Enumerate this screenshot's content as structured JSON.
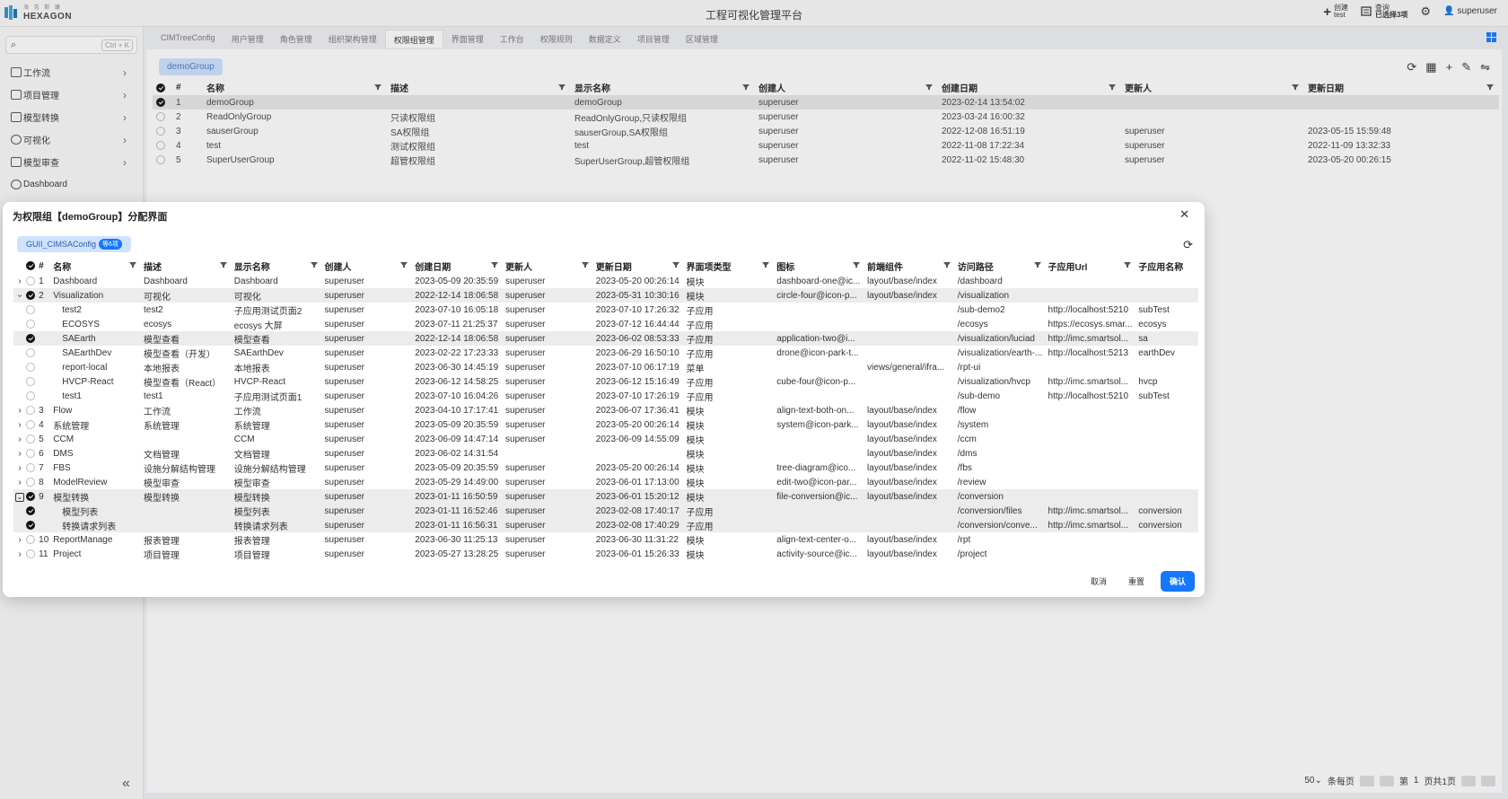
{
  "app": {
    "logo_sub": "海 克 斯 康",
    "logo_name": "HEXAGON",
    "title": "工程可视化管理平台"
  },
  "top_actions": [
    {
      "label": "创建",
      "value": "test",
      "icon": "plus-icon"
    },
    {
      "label": "查询",
      "value": "已选择3项",
      "icon": "query-icon"
    },
    {
      "label": "",
      "value": "",
      "icon": "gear-icon"
    },
    {
      "label": "",
      "value": "superuser",
      "icon": "user-icon"
    }
  ],
  "sidebar": {
    "search_kbd": "Ctrl + K",
    "items": [
      {
        "label": "工作流"
      },
      {
        "label": "项目管理"
      },
      {
        "label": "模型转换"
      },
      {
        "label": "可视化"
      },
      {
        "label": "模型审查"
      },
      {
        "label": "Dashboard"
      }
    ],
    "collapse_glyph": "«"
  },
  "tabs": [
    "CIMTreeConfig",
    "用户管理",
    "角色管理",
    "组织架构管理",
    "权限组管理",
    "界面管理",
    "工作台",
    "权限规则",
    "数据定义",
    "项目管理",
    "区域管理"
  ],
  "active_tab": "权限组管理",
  "main": {
    "group_chip": "demoGroup",
    "columns": [
      "#",
      "名称",
      "描述",
      "显示名称",
      "创建人",
      "创建日期",
      "更新人",
      "更新日期"
    ],
    "rows": [
      {
        "n": "1",
        "name": "demoGroup",
        "desc": "",
        "display": "demoGroup",
        "creator": "superuser",
        "created": "2023-02-14 13:54:02",
        "updater": "",
        "updated": "",
        "checked": true
      },
      {
        "n": "2",
        "name": "ReadOnlyGroup",
        "desc": "只读权限组",
        "display": "ReadOnlyGroup,只读权限组",
        "creator": "superuser",
        "created": "2023-03-24 16:00:32",
        "updater": "",
        "updated": "",
        "checked": false
      },
      {
        "n": "3",
        "name": "sauserGroup",
        "desc": "SA权限组",
        "display": "sauserGroup,SA权限组",
        "creator": "superuser",
        "created": "2022-12-08 16:51:19",
        "updater": "superuser",
        "updated": "2023-05-15 15:59:48",
        "checked": false
      },
      {
        "n": "4",
        "name": "test",
        "desc": "测试权限组",
        "display": "test",
        "creator": "superuser",
        "created": "2022-11-08 17:22:34",
        "updater": "superuser",
        "updated": "2022-11-09 13:32:33",
        "checked": false
      },
      {
        "n": "5",
        "name": "SuperUserGroup",
        "desc": "超管权限组",
        "display": "SuperUserGroup,超管权限组",
        "creator": "superuser",
        "created": "2022-11-02 15:48:30",
        "updater": "superuser",
        "updated": "2023-05-20 00:26:15",
        "checked": false
      }
    ],
    "pager": {
      "size": "50",
      "per_page_label": "条每页",
      "page_prefix": "第",
      "page": "1",
      "page_suffix": "页共1页"
    }
  },
  "modal": {
    "title": "为权限组【demoGroup】分配界面",
    "tag_label": "GUII_CIMSAConfig",
    "tag_count": "等6项",
    "columns": [
      "#",
      "名称",
      "描述",
      "显示名称",
      "创建人",
      "创建日期",
      "更新人",
      "更新日期",
      "界面项类型",
      "图标",
      "前端组件",
      "访问路径",
      "子应用Url",
      "子应用名称"
    ],
    "rows": [
      {
        "exp": "closed",
        "level": 0,
        "checked": false,
        "n": "1",
        "name": "Dashboard",
        "desc": "Dashboard",
        "display": "Dashboard",
        "creator": "superuser",
        "created": "2023-05-09 20:35:59",
        "updater": "superuser",
        "updated": "2023-05-20 00:26:14",
        "type": "模块",
        "icon": "dashboard-one@ic...",
        "comp": "layout/base/index",
        "path": "/dashboard",
        "url": "",
        "app": ""
      },
      {
        "exp": "open",
        "level": 0,
        "checked": true,
        "sel": true,
        "n": "2",
        "name": "Visualization",
        "desc": "可视化",
        "display": "可视化",
        "creator": "superuser",
        "created": "2022-12-14 18:06:58",
        "updater": "superuser",
        "updated": "2023-05-31 10:30:16",
        "type": "模块",
        "icon": "circle-four@icon-p...",
        "comp": "layout/base/index",
        "path": "/visualization",
        "url": "",
        "app": ""
      },
      {
        "exp": "",
        "level": 1,
        "checked": false,
        "n": "",
        "name": "test2",
        "desc": "test2",
        "display": "子应用测试页面2",
        "creator": "superuser",
        "created": "2023-07-10 16:05:18",
        "updater": "superuser",
        "updated": "2023-07-10 17:26:32",
        "type": "子应用",
        "icon": "",
        "comp": "",
        "path": "/sub-demo2",
        "url": "http://localhost:5210",
        "app": "subTest"
      },
      {
        "exp": "",
        "level": 1,
        "checked": false,
        "n": "",
        "name": "ECOSYS",
        "desc": "ecosys",
        "display": "ecosys 大屏",
        "creator": "superuser",
        "created": "2023-07-11 21:25:37",
        "updater": "superuser",
        "updated": "2023-07-12 16:44:44",
        "type": "子应用",
        "icon": "",
        "comp": "",
        "path": "/ecosys",
        "url": "https://ecosys.smar...",
        "app": "ecosys"
      },
      {
        "exp": "",
        "level": 1,
        "checked": true,
        "sel": true,
        "n": "",
        "name": "SAEarth",
        "desc": "模型查看",
        "display": "模型查看",
        "creator": "superuser",
        "created": "2022-12-14 18:06:58",
        "updater": "superuser",
        "updated": "2023-06-02 08:53:33",
        "type": "子应用",
        "icon": "application-two@i...",
        "comp": "",
        "path": "/visualization/luciad",
        "url": "http://imc.smartsol...",
        "app": "sa"
      },
      {
        "exp": "",
        "level": 1,
        "checked": false,
        "n": "",
        "name": "SAEarthDev",
        "desc": "模型查看（开发）",
        "display": "SAEarthDev",
        "creator": "superuser",
        "created": "2023-02-22 17:23:33",
        "updater": "superuser",
        "updated": "2023-06-29 16:50:10",
        "type": "子应用",
        "icon": "drone@icon-park-t...",
        "comp": "",
        "path": "/visualization/earth-...",
        "url": "http://localhost:5213",
        "app": "earthDev"
      },
      {
        "exp": "",
        "level": 1,
        "checked": false,
        "n": "",
        "name": "report-local",
        "desc": "本地报表",
        "display": "本地报表",
        "creator": "superuser",
        "created": "2023-06-30 14:45:19",
        "updater": "superuser",
        "updated": "2023-07-10 06:17:19",
        "type": "菜单",
        "icon": "",
        "comp": "views/general/ifra...",
        "path": "/rpt-ui",
        "url": "",
        "app": ""
      },
      {
        "exp": "",
        "level": 1,
        "checked": false,
        "n": "",
        "name": "HVCP-React",
        "desc": "模型查看（React）",
        "display": "HVCP-React",
        "creator": "superuser",
        "created": "2023-06-12 14:58:25",
        "updater": "superuser",
        "updated": "2023-06-12 15:16:49",
        "type": "子应用",
        "icon": "cube-four@icon-p...",
        "comp": "",
        "path": "/visualization/hvcp",
        "url": "http://imc.smartsol...",
        "app": "hvcp"
      },
      {
        "exp": "",
        "level": 1,
        "checked": false,
        "n": "",
        "name": "test1",
        "desc": "test1",
        "display": "子应用测试页面1",
        "creator": "superuser",
        "created": "2023-07-10 16:04:26",
        "updater": "superuser",
        "updated": "2023-07-10 17:26:19",
        "type": "子应用",
        "icon": "",
        "comp": "",
        "path": "/sub-demo",
        "url": "http://localhost:5210",
        "app": "subTest"
      },
      {
        "exp": "closed",
        "level": 0,
        "checked": false,
        "n": "3",
        "name": "Flow",
        "desc": "工作流",
        "display": "工作流",
        "creator": "superuser",
        "created": "2023-04-10 17:17:41",
        "updater": "superuser",
        "updated": "2023-06-07 17:36:41",
        "type": "模块",
        "icon": "align-text-both-on...",
        "comp": "layout/base/index",
        "path": "/flow",
        "url": "",
        "app": ""
      },
      {
        "exp": "closed",
        "level": 0,
        "checked": false,
        "n": "4",
        "name": "系统管理",
        "desc": "系统管理",
        "display": "系统管理",
        "creator": "superuser",
        "created": "2023-05-09 20:35:59",
        "updater": "superuser",
        "updated": "2023-05-20 00:26:14",
        "type": "模块",
        "icon": "system@icon-park...",
        "comp": "layout/base/index",
        "path": "/system",
        "url": "",
        "app": ""
      },
      {
        "exp": "closed",
        "level": 0,
        "checked": false,
        "n": "5",
        "name": "CCM",
        "desc": "",
        "display": "CCM",
        "creator": "superuser",
        "created": "2023-06-09 14:47:14",
        "updater": "superuser",
        "updated": "2023-06-09 14:55:09",
        "type": "模块",
        "icon": "",
        "comp": "layout/base/index",
        "path": "/ccm",
        "url": "",
        "app": ""
      },
      {
        "exp": "closed",
        "level": 0,
        "checked": false,
        "n": "6",
        "name": "DMS",
        "desc": "文档管理",
        "display": "文档管理",
        "creator": "superuser",
        "created": "2023-06-02 14:31:54",
        "updater": "",
        "updated": "",
        "type": "模块",
        "icon": "",
        "comp": "layout/base/index",
        "path": "/dms",
        "url": "",
        "app": ""
      },
      {
        "exp": "closed",
        "level": 0,
        "checked": false,
        "n": "7",
        "name": "FBS",
        "desc": "设施分解结构管理",
        "display": "设施分解结构管理",
        "creator": "superuser",
        "created": "2023-05-09 20:35:59",
        "updater": "superuser",
        "updated": "2023-05-20 00:26:14",
        "type": "模块",
        "icon": "tree-diagram@ico...",
        "comp": "layout/base/index",
        "path": "/fbs",
        "url": "",
        "app": ""
      },
      {
        "exp": "closed",
        "level": 0,
        "checked": false,
        "n": "8",
        "name": "ModelReview",
        "desc": "模型审查",
        "display": "模型审查",
        "creator": "superuser",
        "created": "2023-05-29 14:49:00",
        "updater": "superuser",
        "updated": "2023-06-01 17:13:00",
        "type": "模块",
        "icon": "edit-two@icon-par...",
        "comp": "layout/base/index",
        "path": "/review",
        "url": "",
        "app": ""
      },
      {
        "exp": "boxed",
        "level": 0,
        "checked": true,
        "sel": true,
        "n": "9",
        "name": "模型转换",
        "desc": "模型转换",
        "display": "模型转换",
        "creator": "superuser",
        "created": "2023-01-11 16:50:59",
        "updater": "superuser",
        "updated": "2023-06-01 15:20:12",
        "type": "模块",
        "icon": "file-conversion@ic...",
        "comp": "layout/base/index",
        "path": "/conversion",
        "url": "",
        "app": ""
      },
      {
        "exp": "",
        "level": 1,
        "checked": true,
        "sel": true,
        "n": "",
        "name": "模型列表",
        "desc": "",
        "display": "模型列表",
        "creator": "superuser",
        "created": "2023-01-11 16:52:46",
        "updater": "superuser",
        "updated": "2023-02-08 17:40:17",
        "type": "子应用",
        "icon": "",
        "comp": "",
        "path": "/conversion/files",
        "url": "http://imc.smartsol...",
        "app": "conversion"
      },
      {
        "exp": "",
        "level": 1,
        "checked": true,
        "sel": true,
        "n": "",
        "name": "转换请求列表",
        "desc": "",
        "display": "转换请求列表",
        "creator": "superuser",
        "created": "2023-01-11 16:56:31",
        "updater": "superuser",
        "updated": "2023-02-08 17:40:29",
        "type": "子应用",
        "icon": "",
        "comp": "",
        "path": "/conversion/conve...",
        "url": "http://imc.smartsol...",
        "app": "conversion"
      },
      {
        "exp": "closed",
        "level": 0,
        "checked": false,
        "n": "10",
        "name": "ReportManage",
        "desc": "报表管理",
        "display": "报表管理",
        "creator": "superuser",
        "created": "2023-06-30 11:25:13",
        "updater": "superuser",
        "updated": "2023-06-30 11:31:22",
        "type": "模块",
        "icon": "align-text-center-o...",
        "comp": "layout/base/index",
        "path": "/rpt",
        "url": "",
        "app": ""
      },
      {
        "exp": "closed",
        "level": 0,
        "checked": false,
        "n": "11",
        "name": "Project",
        "desc": "项目管理",
        "display": "项目管理",
        "creator": "superuser",
        "created": "2023-05-27 13:28:25",
        "updater": "superuser",
        "updated": "2023-06-01 15:26:33",
        "type": "模块",
        "icon": "activity-source@ic...",
        "comp": "layout/base/index",
        "path": "/project",
        "url": "",
        "app": ""
      }
    ],
    "buttons": {
      "cancel": "取消",
      "reset": "重置",
      "confirm": "确认"
    }
  }
}
